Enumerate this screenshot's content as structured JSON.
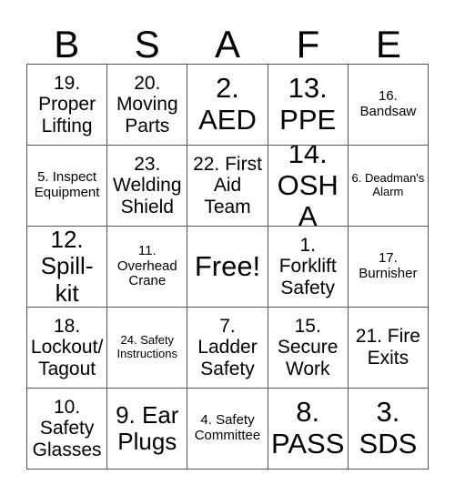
{
  "card": {
    "title_letters": [
      "B",
      "S",
      "A",
      "F",
      "E"
    ],
    "free_space_label": "Free!",
    "border_color": "#555555",
    "text_color": "#000000",
    "background_color": "#ffffff"
  },
  "grid": {
    "columns": 5,
    "rows": 5,
    "cells": [
      {
        "text": "19. Proper Lifting",
        "size": "md"
      },
      {
        "text": "20. Moving Parts",
        "size": "md"
      },
      {
        "text": "2. AED",
        "size": "xl"
      },
      {
        "text": "13. PPE",
        "size": "xl"
      },
      {
        "text": "16. Bandsaw",
        "size": "sm"
      },
      {
        "text": "5. Inspect Equipment",
        "size": "sm"
      },
      {
        "text": "23. Welding Shield",
        "size": "md"
      },
      {
        "text": "22. First Aid Team",
        "size": "md"
      },
      {
        "text": "14. OSHA",
        "size": "xl"
      },
      {
        "text": "6. Deadman's Alarm",
        "size": "xs"
      },
      {
        "text": "12. Spill-kit",
        "size": "lg"
      },
      {
        "text": "11. Overhead Crane",
        "size": "sm"
      },
      {
        "text": "Free!",
        "size": "xl"
      },
      {
        "text": "1. Forklift Safety",
        "size": "md"
      },
      {
        "text": "17. Burnisher",
        "size": "sm"
      },
      {
        "text": "18. Lockout/ Tagout",
        "size": "md"
      },
      {
        "text": "24. Safety Instructions",
        "size": "xs"
      },
      {
        "text": "7. Ladder Safety",
        "size": "md"
      },
      {
        "text": "15. Secure Work",
        "size": "md"
      },
      {
        "text": "21. Fire Exits",
        "size": "md"
      },
      {
        "text": "10. Safety Glasses",
        "size": "md"
      },
      {
        "text": "9. Ear Plugs",
        "size": "lg"
      },
      {
        "text": "4. Safety Committee",
        "size": "sm"
      },
      {
        "text": "8. PASS",
        "size": "xl"
      },
      {
        "text": "3. SDS",
        "size": "xl"
      }
    ]
  }
}
